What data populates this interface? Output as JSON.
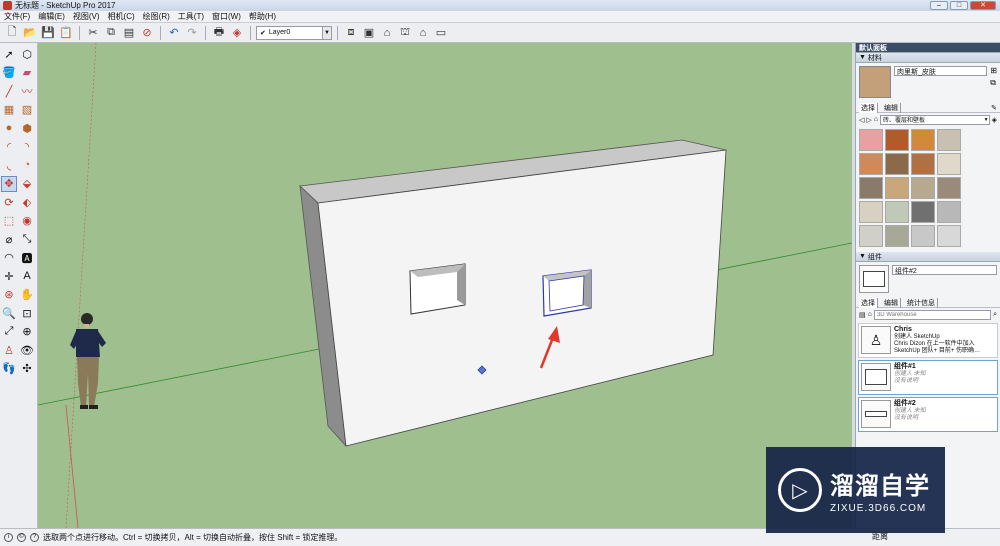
{
  "window": {
    "title": "无标题 - SketchUp Pro 2017",
    "min": "–",
    "max": "□",
    "close": "✕"
  },
  "menu": [
    "文件(F)",
    "编辑(E)",
    "视图(V)",
    "相机(C)",
    "绘图(R)",
    "工具(T)",
    "窗口(W)",
    "帮助(H)"
  ],
  "toolbar": {
    "layer_label": "Layer0",
    "layer_check": "✔"
  },
  "status": {
    "message": "选取两个点进行移动。Ctrl = 切换拷贝，Alt = 切换自动折叠，按住 Shift = 锁定推理。",
    "measure_label": "距离"
  },
  "tray": {
    "title": "默认面板",
    "materials": {
      "header": "材料",
      "name": "肉里斯_皮肤",
      "tab_select": "选择",
      "tab_edit": "编辑",
      "library": "砖、覆层和壁板",
      "swatch_colors": [
        "#e8a0a0",
        "#b35a2a",
        "#d18a3a",
        "#c8c0b0",
        "#d08a5a",
        "#8a6a4a",
        "#b07040",
        "#e0d8c8",
        "#8a7a6a",
        "#c8a878",
        "#b8a890",
        "#9a8a7a",
        "#d8d0c0",
        "#c0c8b8",
        "#707070",
        "#b8b8b8",
        "#d0d0c8",
        "#a8a898",
        "#c8c8c8",
        "#d8d8d8"
      ]
    },
    "components": {
      "header": "组件",
      "name": "组件#2",
      "tab_select": "选择",
      "tab_edit": "编辑",
      "tab_stats": "统计信息",
      "search_placeholder": "3D Warehouse",
      "items": [
        {
          "title": "Chris",
          "line1": "创建人 SketchUp",
          "line2": "Chris Dizon 在上一软件中加入",
          "line3": "SketchUp 团队+ 目前+ 伤职确…"
        },
        {
          "title": "组件#1",
          "line1": "创建人 未知",
          "line2": "没有说明"
        },
        {
          "title": "组件#2",
          "line1": "创建人 未知",
          "line2": "没有说明"
        }
      ]
    }
  },
  "watermark": {
    "title": "溜溜自学",
    "url": "ZIXUE.3D66.COM"
  },
  "colors": {
    "sky_ground": "#9fc08e",
    "wall_face": "#f4f4f4",
    "wall_side": "#8c8c8c",
    "wall_top": "#c8c8c8",
    "arrow": "#e0392b",
    "selection": "#2c3aa8"
  }
}
